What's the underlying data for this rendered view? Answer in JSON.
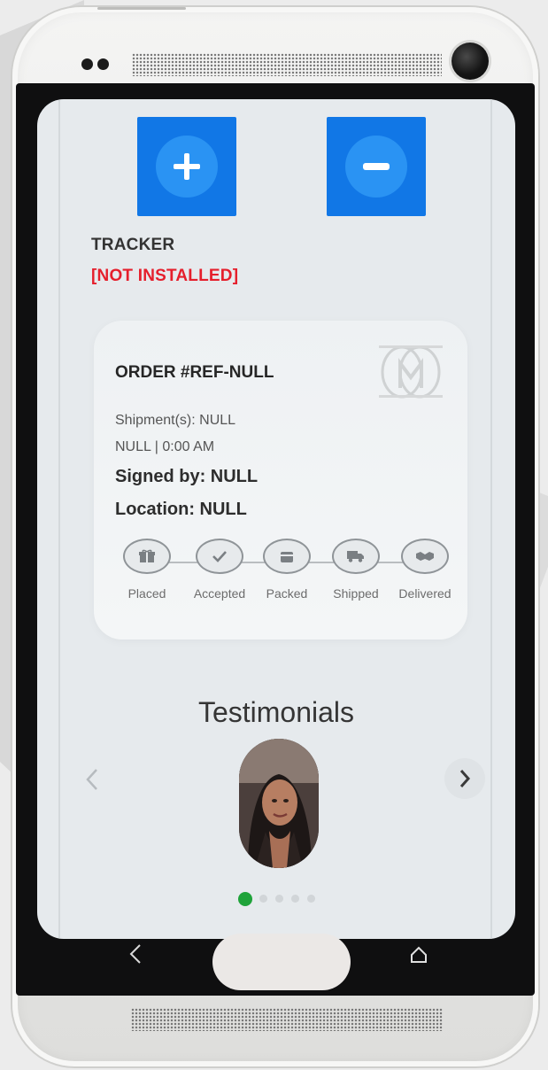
{
  "tracker": {
    "label": "TRACKER",
    "status": "[NOT INSTALLED]"
  },
  "controls": {
    "add_icon": "plus-icon",
    "remove_icon": "minus-icon"
  },
  "order": {
    "title": "ORDER #REF-NULL",
    "shipments": "Shipment(s): NULL",
    "datetime": "NULL | 0:00 AM",
    "signed_by": "Signed by: NULL",
    "location": "Location: NULL",
    "steps": [
      {
        "label": "Placed",
        "icon": "gift-icon"
      },
      {
        "label": "Accepted",
        "icon": "check-icon"
      },
      {
        "label": "Packed",
        "icon": "box-icon"
      },
      {
        "label": "Shipped",
        "icon": "truck-icon"
      },
      {
        "label": "Delivered",
        "icon": "handshake-icon"
      }
    ]
  },
  "testimonials": {
    "title": "Testimonials",
    "dots_total": 5,
    "active_dot": 0
  },
  "colors": {
    "accent_blue": "#1177e6",
    "status_red": "#e51f2c",
    "dot_active": "#1fa33a"
  }
}
